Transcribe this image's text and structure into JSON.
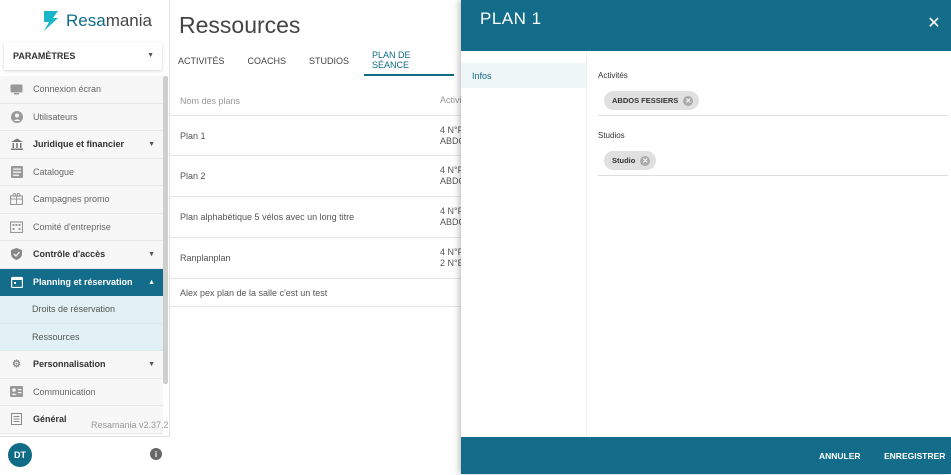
{
  "brand": {
    "name_part1": "Resa",
    "name_part2": "mania",
    "accent": "#136d8a"
  },
  "sidebar": {
    "section_select": "PARAMÈTRES",
    "items": [
      {
        "label": "Connexion écran",
        "icon": "screen-icon"
      },
      {
        "label": "Utilisateurs",
        "icon": "user-icon"
      },
      {
        "label": "Juridique et financier",
        "icon": "bank-icon"
      },
      {
        "label": "Catalogue",
        "icon": "catalog-icon"
      },
      {
        "label": "Campagnes promo",
        "icon": "gift-icon"
      },
      {
        "label": "Comité d'entreprise",
        "icon": "building-icon"
      },
      {
        "label": "Contrôle d'accès",
        "icon": "shield-icon"
      },
      {
        "label": "Planning et réservation",
        "icon": "calendar-icon"
      },
      {
        "label": "Droits de réservation"
      },
      {
        "label": "Ressources"
      },
      {
        "label": "Personnalisation",
        "icon": "gear-icon"
      },
      {
        "label": "Communication",
        "icon": "contact-card-icon"
      },
      {
        "label": "Général",
        "icon": "list-icon"
      }
    ],
    "version": "Resamania v2.37.2",
    "avatar_initials": "DT"
  },
  "main": {
    "title": "Ressources",
    "tabs": [
      "ACTIVITÉS",
      "COACHS",
      "STUDIOS",
      "PLAN DE SÉANCE"
    ],
    "table": {
      "headers": [
        "Nom des plans",
        "Activi"
      ],
      "rows": [
        {
          "name": "Plan 1",
          "col2_line1": "4 N°F",
          "col2_line2": "ABDC"
        },
        {
          "name": "Plan 2",
          "col2_line1": "4 N°F",
          "col2_line2": "ABDC"
        },
        {
          "name": "Plan alphabétique 5 vélos avec un long titre",
          "col2_line1": "4 N°F",
          "col2_line2": "ABDC"
        },
        {
          "name": "Ranplanplan",
          "col2_line1": "4 N°F",
          "col2_line2": "2 N°B"
        },
        {
          "name": "Alex pex plan de la salle c'est un test",
          "col2_line1": "",
          "col2_line2": ""
        }
      ]
    }
  },
  "panel": {
    "title": "PLAN 1",
    "nav": [
      "Infos"
    ],
    "fields": [
      {
        "label": "Activités",
        "chips": [
          "ABDOS FESSIERS"
        ]
      },
      {
        "label": "Studios",
        "chips": [
          "Studio"
        ]
      }
    ],
    "cancel_label": "ANNULER",
    "save_label": "ENREGISTRER"
  }
}
